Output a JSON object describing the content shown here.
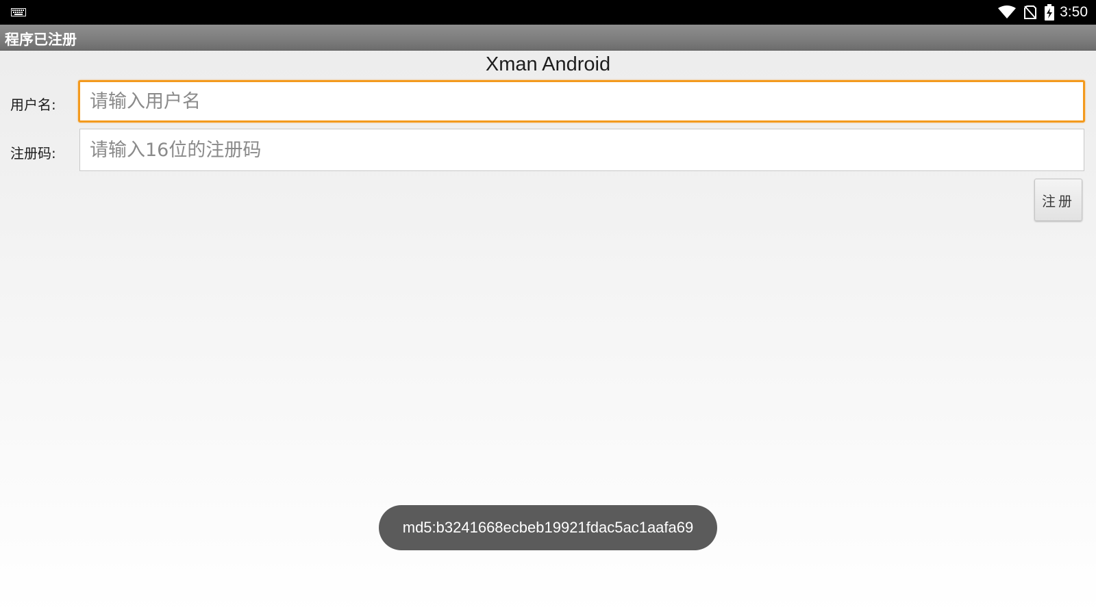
{
  "status_bar": {
    "time": "3:50",
    "icons": [
      "keyboard-icon",
      "wifi-icon",
      "no-sim-icon",
      "battery-charging-icon"
    ]
  },
  "title_bar": {
    "title": "程序已注册"
  },
  "main": {
    "heading": "Xman Android",
    "username_label": "用户名:",
    "username_placeholder": "请输入用户名",
    "username_value": "",
    "code_label": "注册码:",
    "code_placeholder": "请输入16位的注册码",
    "code_value": "",
    "register_button": "注册"
  },
  "toast": {
    "message": "md5:b3241668ecbeb19921fdac5ac1aafa69"
  },
  "colors": {
    "focus_border": "#f39a1e",
    "title_bar": "#7e7e7e",
    "toast_bg": "#5b5b5b"
  }
}
